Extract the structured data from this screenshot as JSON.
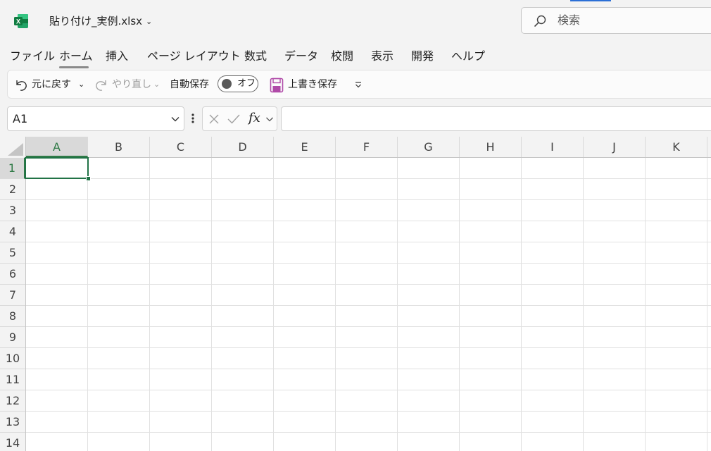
{
  "app": {
    "title": "貼り付け_実例.xlsx",
    "search_placeholder": "検索",
    "accent": "#217346"
  },
  "menu": {
    "tabs": [
      {
        "label": "ファイル"
      },
      {
        "label": "ホーム",
        "active": true
      },
      {
        "label": "挿入"
      },
      {
        "label": "ページ レイアウト"
      },
      {
        "label": "数式"
      },
      {
        "label": "データ"
      },
      {
        "label": "校閲"
      },
      {
        "label": "表示"
      },
      {
        "label": "開発"
      },
      {
        "label": "ヘルプ"
      }
    ]
  },
  "ribbon": {
    "undo_label": "元に戻す",
    "redo_label": "やり直し",
    "autosave_label": "自動保存",
    "autosave_state": "オフ",
    "save_label": "上書き保存"
  },
  "formula_bar": {
    "namebox_value": "A1",
    "fx_label": "fx",
    "formula_value": ""
  },
  "sheet": {
    "columns": [
      "A",
      "B",
      "C",
      "D",
      "E",
      "F",
      "G",
      "H",
      "I",
      "J",
      "K"
    ],
    "rows": [
      "1",
      "2",
      "3",
      "4",
      "5",
      "6",
      "7",
      "8",
      "9",
      "10",
      "11",
      "12",
      "13",
      "14"
    ],
    "active_cell": "A1"
  }
}
